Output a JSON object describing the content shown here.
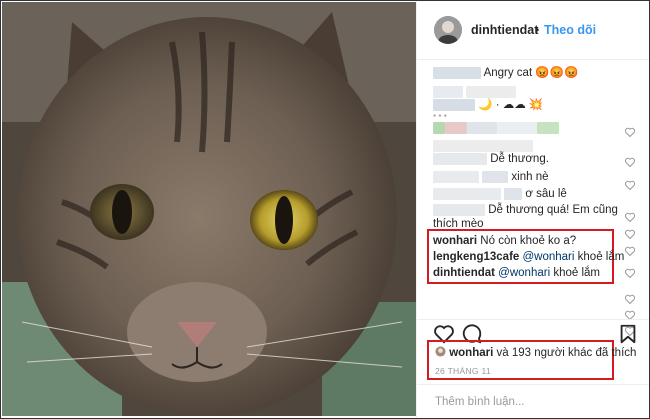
{
  "post": {
    "username": "dinhtiendat",
    "follow_label": "Theo dõi",
    "separator": "•"
  },
  "comments": [
    {
      "user": "",
      "text": "Angry cat 😡😡😡"
    },
    {
      "user": "",
      "text": "🌙 · ☁☁ 💥"
    },
    {
      "user": "",
      "text": "* * *"
    },
    {
      "user": "",
      "text": ""
    },
    {
      "user": "",
      "text": "Dễ thương."
    },
    {
      "user": "",
      "text": "xinh nè"
    },
    {
      "user": "",
      "text": "ơ sâu lê"
    },
    {
      "user": "",
      "text": "Dễ thương quá! Em cũng thích mèo"
    },
    {
      "user": "wonhari",
      "text": "Nó còn khoẻ ko a?"
    },
    {
      "user": "lengkeng13cafe",
      "mention": "@wonhari",
      "text": "khoẻ lắm"
    },
    {
      "user": "dinhtiendat",
      "mention": "@wonhari",
      "text": "khoẻ lắm"
    }
  ],
  "likes": {
    "user": "wonhari",
    "rest": "và 193 người khác đã thích"
  },
  "date": "26 THÁNG 11",
  "add_comment": {
    "placeholder": "Thêm bình luận..."
  },
  "icons": [
    "heart-icon",
    "comment-icon",
    "bookmark-icon"
  ],
  "colors": {
    "highlight_box": "#d71920",
    "link": "#3897f0"
  }
}
